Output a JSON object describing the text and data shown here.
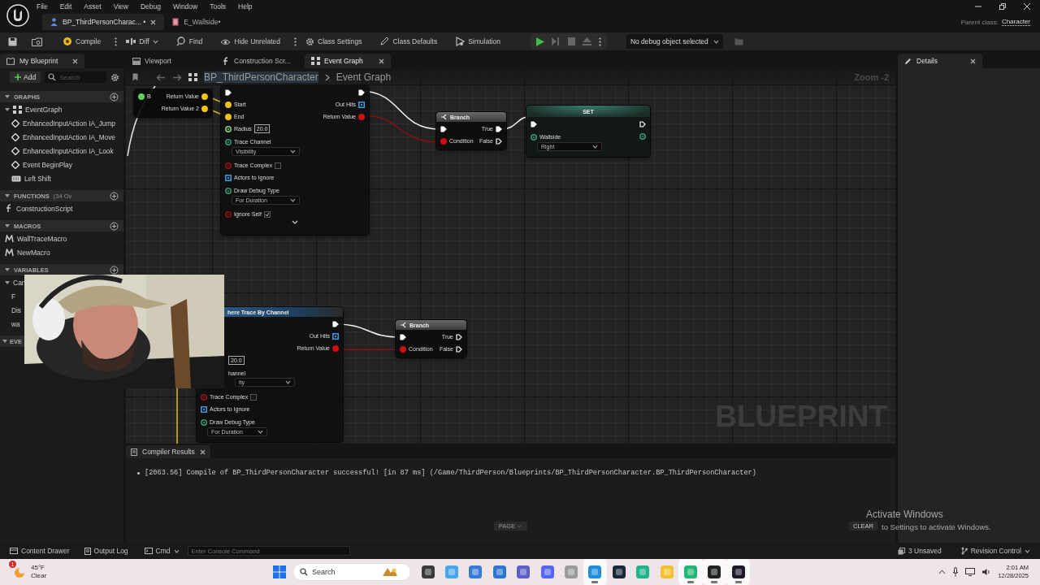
{
  "menu": [
    "File",
    "Edit",
    "Asset",
    "View",
    "Debug",
    "Window",
    "Tools",
    "Help"
  ],
  "document_tabs": [
    {
      "label": "BP_ThirdPersonCharac... •",
      "kind": "blueprint",
      "selected": true
    },
    {
      "label": "E_Wallside•",
      "kind": "enum",
      "selected": false
    }
  ],
  "parent_class": {
    "label": "Parent class:",
    "value": "Character"
  },
  "toolbar": {
    "buttons": [
      {
        "kind": "compile",
        "label": "Compile",
        "options": true
      },
      {
        "kind": "diff",
        "label": "Diff",
        "options": false
      },
      {
        "kind": "find",
        "label": "Find",
        "options": false
      },
      {
        "kind": "hide_unrelated",
        "label": "Hide Unrelated",
        "options": true
      },
      {
        "kind": "class_settings",
        "label": "Class Settings",
        "options": false
      },
      {
        "kind": "class_defaults",
        "label": "Class Defaults",
        "options": false
      },
      {
        "kind": "simulation",
        "label": "Simulation",
        "options": false
      }
    ],
    "debug_object": "No debug object selected"
  },
  "my_blueprint": {
    "title": "My Blueprint",
    "add_label": "Add",
    "search_placeholder": "Search",
    "sections": [
      {
        "title": "GRAPHS",
        "expanded": true,
        "items": [
          {
            "label": "EventGraph",
            "kind": "graph",
            "expanded": true,
            "children": [
              {
                "label": "EnhancedInputAction IA_Jump",
                "kind": "event"
              },
              {
                "label": "EnhancedInputAction IA_Move",
                "kind": "event"
              },
              {
                "label": "EnhancedInputAction IA_Look",
                "kind": "event"
              },
              {
                "label": "Event BeginPlay",
                "kind": "event"
              },
              {
                "label": "Left Shift",
                "kind": "key"
              }
            ]
          }
        ]
      },
      {
        "title": "FUNCTIONS",
        "count": "(34 Ov",
        "expanded": true,
        "items": [
          {
            "label": "ConstructionScript",
            "kind": "function"
          }
        ]
      },
      {
        "title": "MACROS",
        "expanded": true,
        "items": [
          {
            "label": "WallTraceMacro",
            "kind": "macro"
          },
          {
            "label": "NewMacro",
            "kind": "macro"
          }
        ]
      },
      {
        "title": "VARIABLES",
        "expanded": true,
        "items": [
          {
            "label": "Can",
            "kind": "category",
            "expanded": true,
            "children": [
              {
                "label": "F",
                "kind": "variable"
              },
              {
                "label": "Dis",
                "kind": "variable"
              },
              {
                "label": "wa",
                "kind": "variable"
              }
            ]
          }
        ]
      },
      {
        "title": "EVE",
        "expanded": true
      }
    ]
  },
  "editor_tabs": [
    {
      "label": "Viewport",
      "kind": "viewport",
      "selected": false
    },
    {
      "label": "Construction Scr...",
      "kind": "function",
      "selected": false
    },
    {
      "label": "Event Graph",
      "kind": "graph",
      "selected": true
    }
  ],
  "graph": {
    "breadcrumb": [
      "BP_ThirdPersonCharacter",
      "Event Graph"
    ],
    "zoom": "Zoom -2",
    "watermark": "BLUEPRINT",
    "nodes": [
      {
        "kind": "make",
        "inputs": [
          {
            "kind": "data",
            "label": "B",
            "color": "#5fd35f",
            "connected": true
          }
        ],
        "outputs": [
          {
            "kind": "data",
            "label": "Return Value",
            "color": "#f2c21b",
            "connected": true
          },
          {
            "kind": "data",
            "label": "Return Value 2",
            "color": "#f2c21b",
            "connected": true
          }
        ]
      },
      {
        "kind": "trace",
        "advanced_toggle": true,
        "inputs": [
          {
            "kind": "exec",
            "connected": true
          },
          {
            "kind": "data",
            "label": "Start",
            "color": "#f2c21b",
            "connected": true
          },
          {
            "kind": "data",
            "label": "End",
            "color": "#f2c21b",
            "connected": true
          },
          {
            "kind": "field",
            "label": "Radius",
            "value": "20.0",
            "color": "#7ed67e",
            "connected": false
          },
          {
            "kind": "dropdown",
            "label": "Trace Channel",
            "value": "Visibility",
            "color": "#2f9e6f",
            "connected": false
          },
          {
            "kind": "checkbox",
            "label": "Trace Complex",
            "checked": false,
            "color": "#9a1010",
            "connected": false
          },
          {
            "kind": "array",
            "label": "Actors to Ignore",
            "color": "#3a9ae0",
            "connected": false
          },
          {
            "kind": "dropdown",
            "label": "Draw Debug Type",
            "value": "For Duration",
            "color": "#2f9e6f",
            "connected": false
          },
          {
            "kind": "checkbox",
            "label": "Ignore Self",
            "checked": true,
            "color": "#9a1010",
            "connected": false
          }
        ],
        "outputs": [
          {
            "kind": "exec",
            "connected": true
          },
          {
            "kind": "array",
            "label": "Out Hits",
            "color": "#3a9ae0",
            "connected": false
          },
          {
            "kind": "data",
            "label": "Return Value",
            "color": "#d01010",
            "connected": true
          }
        ]
      },
      {
        "kind": "branch",
        "title": "Branch",
        "inputs": [
          {
            "kind": "exec",
            "connected": true
          },
          {
            "kind": "data",
            "label": "Condition",
            "color": "#d01010",
            "connected": true
          }
        ],
        "outputs": [
          {
            "kind": "exec",
            "label": "True",
            "connected": true
          },
          {
            "kind": "exec",
            "label": "False",
            "connected": false
          }
        ]
      },
      {
        "kind": "set",
        "title": "SET",
        "inputs": [
          {
            "kind": "exec",
            "connected": true
          },
          {
            "kind": "dropdown",
            "label": "Wallside",
            "value": "Right",
            "color": "#2f9e6f",
            "connected": false
          }
        ],
        "outputs": [
          {
            "kind": "exec",
            "connected": false
          },
          {
            "kind": "data",
            "color": "#2f9e6f",
            "connected": false
          }
        ]
      },
      {
        "kind": "trace",
        "title": "here Trace By Channel",
        "inputs": [
          {
            "kind": "field",
            "value": "20.0"
          },
          {
            "kind": "dropdown",
            "label": "hannel",
            "value": "ity"
          },
          {
            "kind": "checkbox",
            "label": "Trace Complex",
            "checked": false,
            "color": "#9a1010",
            "connected": false
          },
          {
            "kind": "array",
            "label": "Actors to Ignore",
            "color": "#3a9ae0",
            "connected": false
          },
          {
            "kind": "dropdown",
            "label": "Draw Debug Type",
            "value": "For Duration",
            "color": "#2f9e6f",
            "connected": false
          }
        ],
        "outputs": [
          {
            "kind": "exec",
            "connected": true
          },
          {
            "kind": "array",
            "label": "Out Hits",
            "color": "#3a9ae0",
            "connected": false
          },
          {
            "kind": "data",
            "label": "Return Value",
            "color": "#d01010",
            "connected": true
          }
        ]
      },
      {
        "kind": "branch",
        "title": "Branch",
        "inputs": [
          {
            "kind": "exec",
            "connected": true
          },
          {
            "kind": "data",
            "label": "Condition",
            "color": "#d01010",
            "connected": true
          }
        ],
        "outputs": [
          {
            "kind": "exec",
            "label": "True",
            "connected": false
          },
          {
            "kind": "exec",
            "label": "False",
            "connected": false
          }
        ]
      }
    ]
  },
  "compiler_results": {
    "title": "Compiler Results",
    "messages": [
      "[2063.56] Compile of BP_ThirdPersonCharacter successful! [in 87 ms] (/Game/ThirdPerson/Blueprints/BP_ThirdPersonCharacter.BP_ThirdPersonCharacter)"
    ],
    "page": "PAGE",
    "clear": "CLEAR"
  },
  "details": {
    "title": "Details"
  },
  "status_bar": {
    "content_drawer": "Content Drawer",
    "output_log": "Output Log",
    "cmd": "Cmd",
    "console_placeholder": "Enter Console Command",
    "unsaved": "3 Unsaved",
    "revision_control": "Revision Control"
  },
  "activation_notice": {
    "title": "Activate Windows",
    "message": "to Settings to activate Windows."
  },
  "webcam": {
    "kind": "picture"
  },
  "taskbar": {
    "weather": {
      "temperature": "45°F",
      "condition": "Clear",
      "badge": "1"
    },
    "search_placeholder": "Search",
    "apps": [
      {
        "color": "#3a3a3a",
        "running": false
      },
      {
        "color": "#49a5e8",
        "running": false
      },
      {
        "color": "#3b7bd8",
        "running": false
      },
      {
        "color": "#2d75d0",
        "running": false
      },
      {
        "color": "#5b5fc7",
        "running": false
      },
      {
        "color": "#5865f2",
        "running": false
      },
      {
        "color": "#9a9a9a",
        "running": false
      },
      {
        "color": "#1e8fd8",
        "running": true
      },
      {
        "color": "#1b2838",
        "running": false
      },
      {
        "color": "#20b08a",
        "running": false
      },
      {
        "color": "#f2c230",
        "running": false
      },
      {
        "color": "#22b573",
        "running": true
      },
      {
        "color": "#222222",
        "running": true
      },
      {
        "color": "#1a1a2a",
        "running": true
      }
    ],
    "clock": {
      "time": "2:01 AM",
      "date": "12/28/2025"
    }
  }
}
